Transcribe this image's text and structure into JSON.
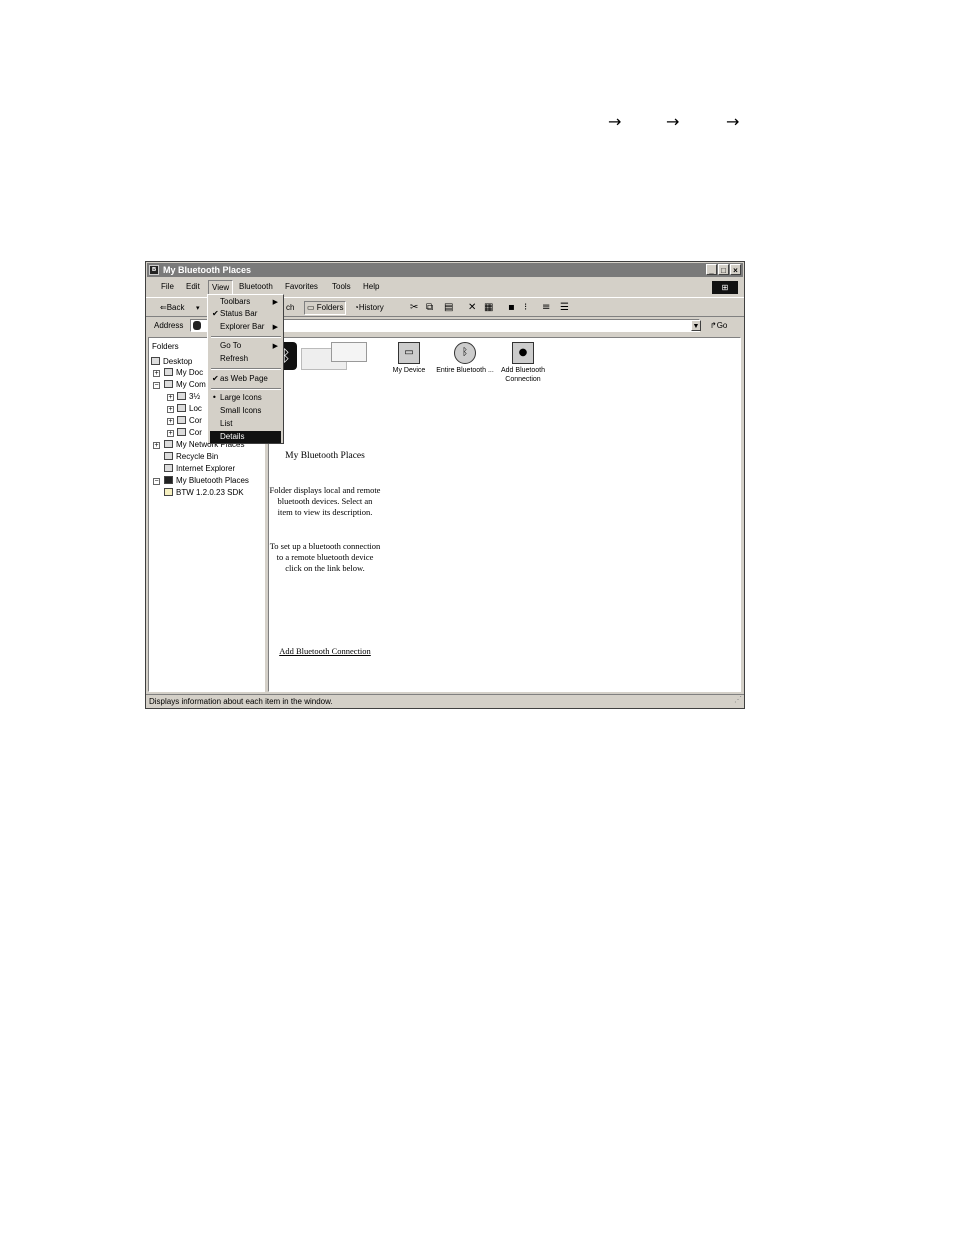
{
  "arrows": [
    "→",
    "→",
    "→"
  ],
  "window": {
    "title": "My Bluetooth Places"
  },
  "menubar": [
    "File",
    "Edit",
    "View",
    "Bluetooth",
    "Favorites",
    "Tools",
    "Help"
  ],
  "toolbar": {
    "back": "⇐Back",
    "search_fragment": "ch",
    "folders": "Folders",
    "history": "History"
  },
  "address": {
    "label": "Address",
    "go": "Go"
  },
  "folders_pane": {
    "header": "Folders",
    "items": [
      "Desktop",
      "My Doc",
      "My Com",
      "3½",
      "Loc",
      "Cor",
      "Cor",
      "My Network Places",
      "Recycle Bin",
      "Internet Explorer",
      "My Bluetooth Places",
      "BTW 1.2.0.23 SDK"
    ]
  },
  "devices": [
    {
      "label": "My Device",
      "icon": "laptop-icon"
    },
    {
      "label": "Entire Bluetooth ...",
      "icon": "globe-icon"
    },
    {
      "label": "Add Bluetooth Connection",
      "icon": "wizard-icon"
    }
  ],
  "description": {
    "title": "My Bluetooth Places",
    "p1": "Folder displays local and remote bluetooth devices. Select an item to view its description.",
    "p2": "To set up a bluetooth connection to a remote bluetooth device click on the link below.",
    "link": "Add Bluetooth Connection"
  },
  "view_menu": {
    "toolbars": "Toolbars",
    "status_bar": "Status Bar",
    "explorer_bar": "Explorer Bar",
    "go_to": "Go To",
    "refresh": "Refresh",
    "web_page": "as Web Page",
    "large_icons": "Large Icons",
    "small_icons": "Small Icons",
    "list": "List",
    "details": "Details"
  },
  "status": "Displays information about each item in the window."
}
